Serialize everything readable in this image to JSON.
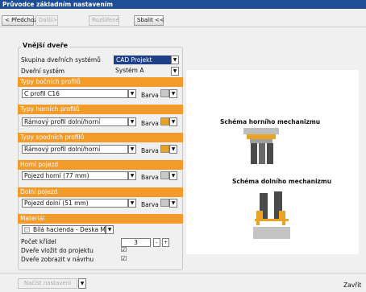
{
  "window": {
    "title": "Průvodce základním nastavením"
  },
  "toolbar": {
    "back": "< Předchozí",
    "next": "Další>",
    "extended": "Rozšířené",
    "collapse": "Sbalit <<"
  },
  "section": {
    "title": "Vnější dveře",
    "system_group_label": "Skupina dveřních systémů",
    "system_group_value": "CAD Projekt",
    "door_system_label": "Dveřní systém",
    "door_system_value": "Systém A",
    "side_profiles_band": "Typy bočních profilů",
    "side_profile_value": "C profil C16",
    "color_label": "Barva",
    "top_profiles_band": "Typy horních profilů",
    "top_profile_value": "Rámový profil dolní/horní",
    "bottom_profiles_band": "Typy spodních profilů",
    "bottom_profile_value": "Rámový profil dolní/horní",
    "top_rail_band": "Horní pojezd",
    "top_rail_value": "Pojezd horní (77 mm)",
    "bottom_rail_band": "Dolní pojezd",
    "bottom_rail_value": "Pojezd dolní (51 mm)",
    "material_band": "Materiál",
    "material_value": "Bílá hacienda - Deska MDF",
    "wings_label": "Počet křídel",
    "wings_value": "3",
    "minus": "-",
    "plus": "+",
    "insert_label": "Dveře vložit do projektu",
    "show_label": "Dveře zobrazit v návrhu",
    "check_mark": "☑"
  },
  "schemes": {
    "top": "Schéma horního mechanizmu",
    "bottom": "Schéma dolního mechanizmu"
  },
  "footer": {
    "load": "Načíst nastavení",
    "close": "Zavřít"
  },
  "colors": {
    "accent": "#f29b2a",
    "title_bar": "#1f4e97",
    "swatch_gray": "#c8c8c8",
    "swatch_orange": "#e8a325"
  }
}
